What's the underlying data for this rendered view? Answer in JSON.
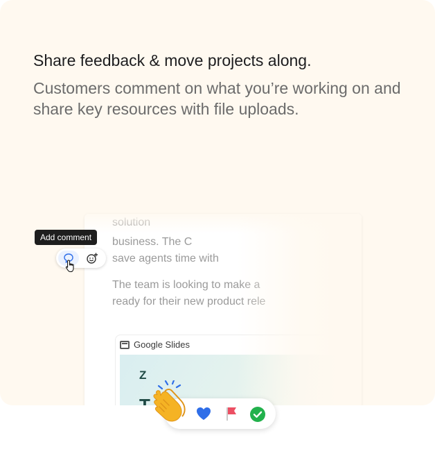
{
  "hero": {
    "headline": "Share feedback & move projects along.",
    "subhead": "Customers comment on what you’re working on and share key resources with file uploads."
  },
  "document": {
    "lines": [
      "solution",
      "business. The C",
      "save agents time with",
      "The team is looking to make a",
      "ready for their new product rele"
    ],
    "attachment": {
      "title": "Google Slides",
      "thumbnail_text_1": "Z",
      "thumbnail_text_2": "T"
    }
  },
  "toolbar": {
    "tooltip": "Add comment",
    "comment_icon": "comment-bubble-icon",
    "emoji_icon": "add-emoji-icon"
  },
  "reactions": {
    "items": [
      "clapping-hands-icon",
      "heart-icon",
      "flag-icon",
      "check-icon"
    ],
    "colors": {
      "heart": "#2f6ee8",
      "flag": "#ec4f63",
      "check": "#22b14c"
    }
  },
  "colors": {
    "card_bg": "#fff9f0",
    "tooltip_bg": "#1e1e1e",
    "accent": "#2f6ee8"
  }
}
